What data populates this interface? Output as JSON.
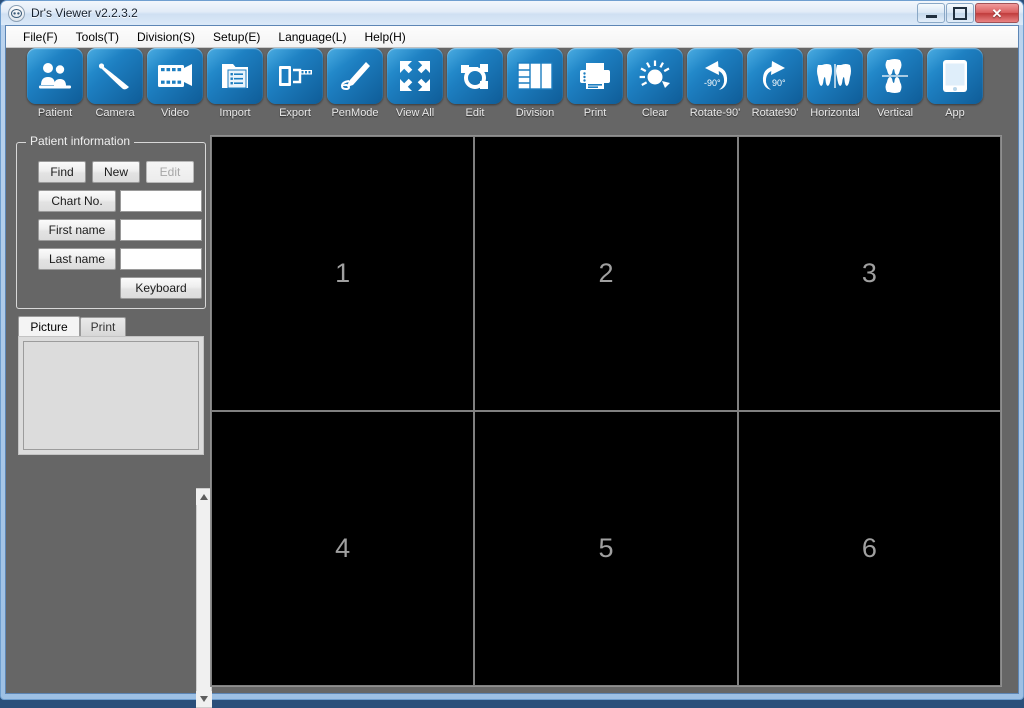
{
  "window": {
    "title": "Dr's Viewer v2.2.3.2",
    "title_icon": "app-logo-icon",
    "buttons": {
      "minimize": "Minimize",
      "maximize": "Maximize",
      "close": "Close",
      "close_glyph": "✕"
    }
  },
  "menubar": {
    "items": [
      {
        "label": "File(F)"
      },
      {
        "label": "Tools(T)"
      },
      {
        "label": "Division(S)"
      },
      {
        "label": "Setup(E)"
      },
      {
        "label": "Language(L)"
      },
      {
        "label": "Help(H)"
      }
    ]
  },
  "toolbar": {
    "buttons": [
      {
        "label": "Patient",
        "icon": "patient-icon"
      },
      {
        "label": "Camera",
        "icon": "camera-probe-icon"
      },
      {
        "label": "Video",
        "icon": "video-film-icon"
      },
      {
        "label": "Import",
        "icon": "import-folder-icon"
      },
      {
        "label": "Export",
        "icon": "export-film-icon"
      },
      {
        "label": "PenMode",
        "icon": "pen-icon"
      },
      {
        "label": "View All",
        "icon": "expand-arrows-icon"
      },
      {
        "label": "Edit",
        "icon": "edit-nodes-icon"
      },
      {
        "label": "Division",
        "icon": "grid-division-icon"
      },
      {
        "label": "Print",
        "icon": "printer-icon"
      },
      {
        "label": "Clear",
        "icon": "clear-dial-icon"
      },
      {
        "label": "Rotate-90'",
        "icon": "rotate-left-icon"
      },
      {
        "label": "Rotate90'",
        "icon": "rotate-right-icon"
      },
      {
        "label": "Horizontal",
        "icon": "flip-horizontal-teeth-icon"
      },
      {
        "label": "Vertical",
        "icon": "flip-vertical-teeth-icon"
      },
      {
        "label": "App",
        "icon": "tablet-app-icon"
      }
    ]
  },
  "patient_panel": {
    "group_title": "Patient information",
    "actions": [
      {
        "label": "Find",
        "disabled": false
      },
      {
        "label": "New",
        "disabled": false
      },
      {
        "label": "Edit",
        "disabled": true
      }
    ],
    "fields": [
      {
        "label": "Chart No.",
        "value": "",
        "placeholder": ""
      },
      {
        "label": "First name",
        "value": "",
        "placeholder": ""
      },
      {
        "label": "Last name",
        "value": "",
        "placeholder": ""
      }
    ],
    "keyboard_button": "Keyboard"
  },
  "tabs": {
    "items": [
      {
        "label": "Picture",
        "active": true
      },
      {
        "label": "Print",
        "active": false
      }
    ]
  },
  "thumbnail_list": {
    "items": [],
    "scrollbar": {
      "up_arrow": "scroll-up-arrow-icon",
      "down_arrow": "scroll-down-arrow-icon"
    }
  },
  "viewer": {
    "layout": "3x2",
    "cells": [
      {
        "label": "1"
      },
      {
        "label": "2"
      },
      {
        "label": "3"
      },
      {
        "label": "4"
      },
      {
        "label": "5"
      },
      {
        "label": "6"
      }
    ]
  },
  "colors": {
    "toolbar_bg": "#666666",
    "icon_blue": "#1d7ec0",
    "viewer_bg": "#000000",
    "grid_line": "#808080",
    "cell_number": "#a0a0a0",
    "window_frame": "#9dc0e4"
  }
}
